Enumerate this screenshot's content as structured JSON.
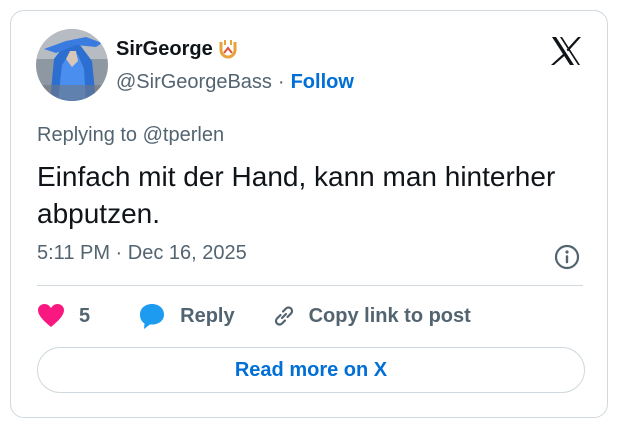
{
  "author": {
    "display_name": "SirGeorge",
    "handle": "@SirGeorgeBass",
    "separator": "·",
    "follow_label": "Follow"
  },
  "reply_context": {
    "prefix": "Replying to",
    "mention": "@tperlen"
  },
  "tweet": {
    "text": "Einfach mit der Hand, kann man hinterher abputzen.",
    "timestamp": "5:11 PM · Dec 16, 2025"
  },
  "actions": {
    "like_count": "5",
    "reply_label": "Reply",
    "copy_label": "Copy link to post"
  },
  "read_more_label": "Read more on X",
  "icons": {
    "like": "heart-icon",
    "reply": "speech-bubble-icon",
    "copy": "link-icon",
    "info": "info-icon",
    "logo": "x-logo-icon",
    "badge": "horseshoe-badge-icon"
  },
  "colors": {
    "like": "#f91880",
    "reply": "#1d9bf0",
    "link": "#006fd6",
    "muted": "#536471",
    "text": "#0f1419",
    "border": "#cfd9de"
  }
}
